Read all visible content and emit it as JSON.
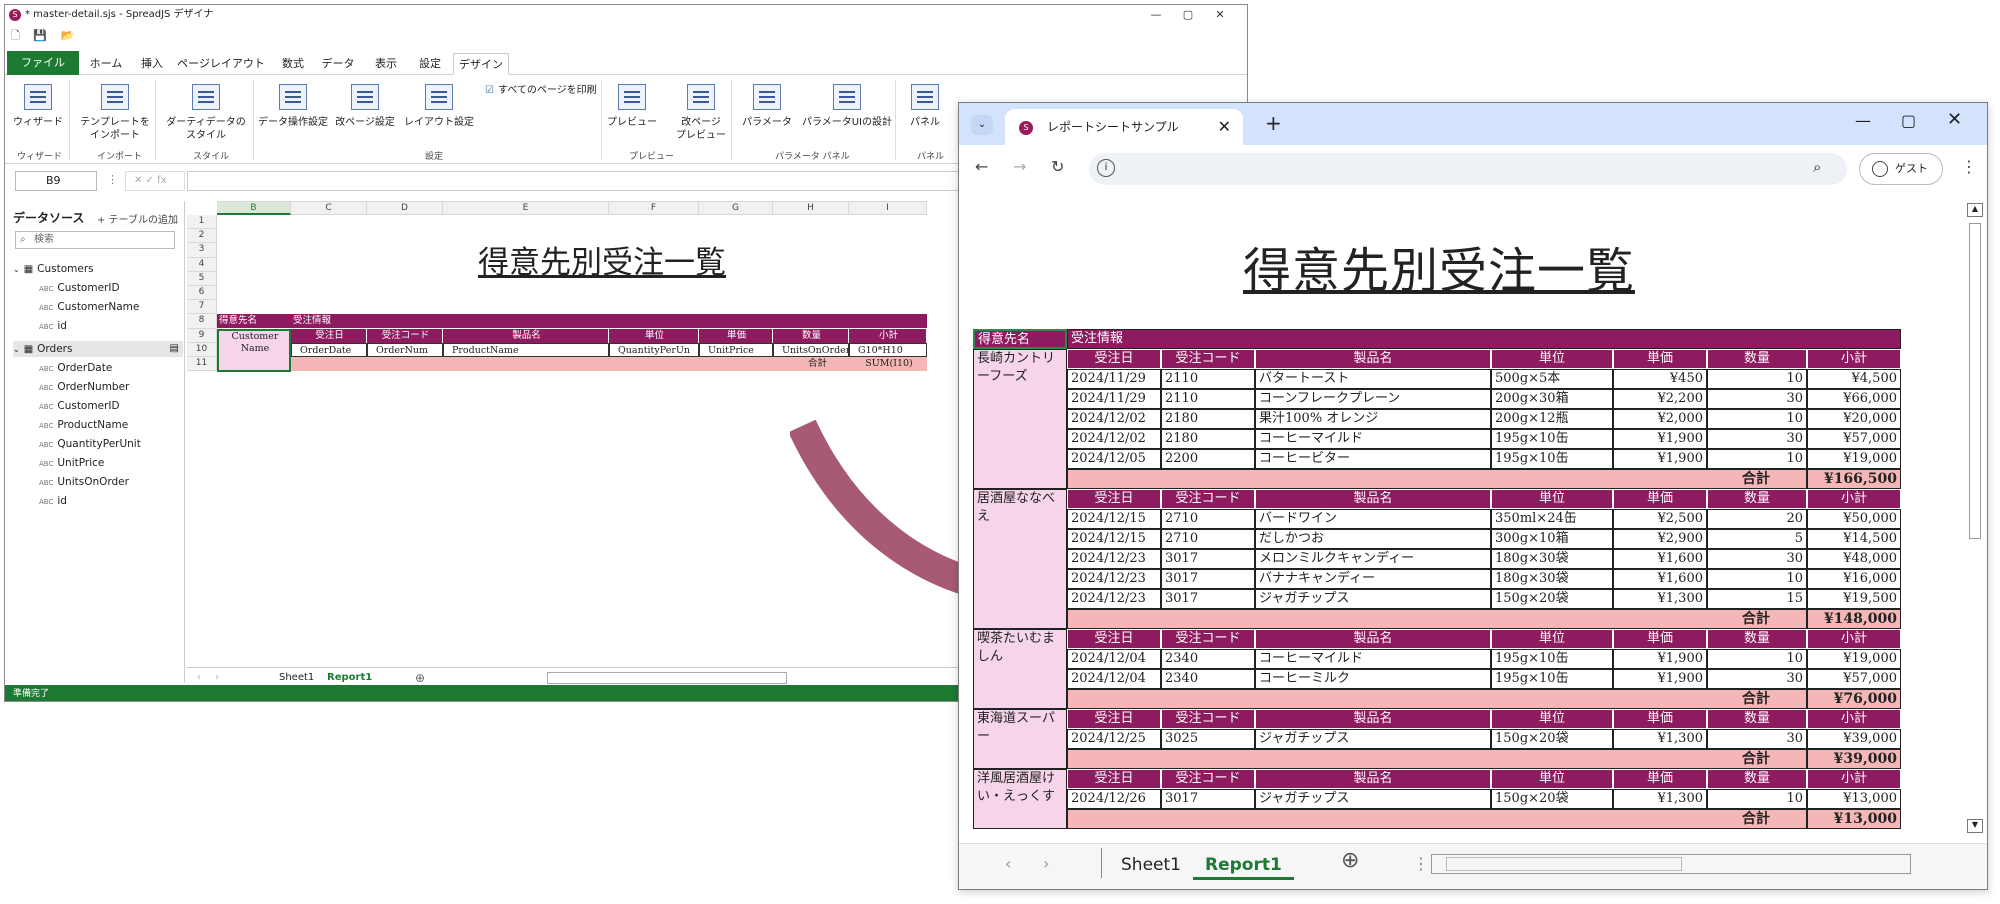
{
  "designer": {
    "title": "* master-detail.sjs - SpreadJS デザイナ",
    "tabs": [
      "ファイル",
      "ホーム",
      "挿入",
      "ページレイアウト",
      "数式",
      "データ",
      "表示",
      "設定",
      "デザイン"
    ],
    "ribbon": {
      "buttons": [
        "ウィザード",
        "テンプレートを\nインポート",
        "ダーティデータの\nスタイル",
        "データ操作設定",
        "改ページ設定",
        "レイアウト設定",
        "すべてのページを印刷",
        "プレビュー",
        "改ページ\nプレビュー",
        "パラメータ",
        "パラメータUIの設計",
        "パネル"
      ],
      "groups": [
        "ウィザード",
        "インポート",
        "スタイル",
        "設定",
        "プレビュー",
        "パラメータ パネル",
        "パネル"
      ]
    },
    "namebox": "B9",
    "fx": "fx",
    "datasource": {
      "title": "データソース",
      "add_table": "+ テーブルの追加",
      "search_placeholder": "検索",
      "tables": [
        {
          "name": "Customers",
          "fields": [
            "CustomerID",
            "CustomerName",
            "id"
          ]
        },
        {
          "name": "Orders",
          "fields": [
            "OrderDate",
            "OrderNumber",
            "CustomerID",
            "ProductName",
            "QuantityPerUnit",
            "UnitPrice",
            "UnitsOnOrder",
            "id"
          ]
        }
      ]
    },
    "columns": [
      "B",
      "C",
      "D",
      "E",
      "F",
      "G",
      "H",
      "I"
    ],
    "rows": [
      "1",
      "2",
      "3",
      "4",
      "5",
      "6",
      "7",
      "8",
      "9",
      "10",
      "11"
    ],
    "sheet_title": "得意先別受注一覧",
    "template": {
      "customer_header": "得意先名",
      "order_header": "受注情報",
      "field_headers": [
        "受注日",
        "受注コード",
        "製品名",
        "単位",
        "単価",
        "数量",
        "小計"
      ],
      "customer_field": "Customer\nName",
      "binding_cells": [
        "OrderDate",
        "OrderNum",
        "ProductName",
        "QuantityPerUn",
        "UnitPrice",
        "UnitsOnOrder",
        "G10*H10"
      ],
      "total_label": "合計",
      "total_formula": "SUM(I10)"
    },
    "sheet_tabs": [
      "Sheet1",
      "Report1"
    ],
    "status": "準備完了"
  },
  "browser": {
    "tab_title": "レポートシートサンプル",
    "guest_label": "ゲスト",
    "report_title": "得意先別受注一覧",
    "customer_header": "得意先名",
    "order_header": "受注情報",
    "field_headers": [
      "受注日",
      "受注コード",
      "製品名",
      "単位",
      "単価",
      "数量",
      "小計"
    ],
    "total_label": "合計",
    "groups": [
      {
        "customer": "長崎カントリーフーズ",
        "rows": [
          [
            "2024/11/29",
            "2110",
            "バタートースト",
            "500g×5本",
            "¥450",
            "10",
            "¥4,500"
          ],
          [
            "2024/11/29",
            "2110",
            "コーンフレークプレーン",
            "200g×30箱",
            "¥2,200",
            "30",
            "¥66,000"
          ],
          [
            "2024/12/02",
            "2180",
            "果汁100% オレンジ",
            "200g×12瓶",
            "¥2,000",
            "10",
            "¥20,000"
          ],
          [
            "2024/12/02",
            "2180",
            "コーヒーマイルド",
            "195g×10缶",
            "¥1,900",
            "30",
            "¥57,000"
          ],
          [
            "2024/12/05",
            "2200",
            "コーヒービター",
            "195g×10缶",
            "¥1,900",
            "10",
            "¥19,000"
          ]
        ],
        "total": "¥166,500"
      },
      {
        "customer": "居酒屋ななべえ",
        "rows": [
          [
            "2024/12/15",
            "2710",
            "バードワイン",
            "350ml×24缶",
            "¥2,500",
            "20",
            "¥50,000"
          ],
          [
            "2024/12/15",
            "2710",
            "だしかつお",
            "300g×10箱",
            "¥2,900",
            "5",
            "¥14,500"
          ],
          [
            "2024/12/23",
            "3017",
            "メロンミルクキャンディー",
            "180g×30袋",
            "¥1,600",
            "30",
            "¥48,000"
          ],
          [
            "2024/12/23",
            "3017",
            "バナナキャンディー",
            "180g×30袋",
            "¥1,600",
            "10",
            "¥16,000"
          ],
          [
            "2024/12/23",
            "3017",
            "ジャガチップス",
            "150g×20袋",
            "¥1,300",
            "15",
            "¥19,500"
          ]
        ],
        "total": "¥148,000"
      },
      {
        "customer": "喫茶たいむましん",
        "rows": [
          [
            "2024/12/04",
            "2340",
            "コーヒーマイルド",
            "195g×10缶",
            "¥1,900",
            "10",
            "¥19,000"
          ],
          [
            "2024/12/04",
            "2340",
            "コーヒーミルク",
            "195g×10缶",
            "¥1,900",
            "30",
            "¥57,000"
          ]
        ],
        "total": "¥76,000"
      },
      {
        "customer": "東海道スーパー",
        "rows": [
          [
            "2024/12/25",
            "3025",
            "ジャガチップス",
            "150g×20袋",
            "¥1,300",
            "30",
            "¥39,000"
          ]
        ],
        "total": "¥39,000"
      },
      {
        "customer": "洋風居酒屋けい・えっくす",
        "rows": [
          [
            "2024/12/26",
            "3017",
            "ジャガチップス",
            "150g×20袋",
            "¥1,300",
            "10",
            "¥13,000"
          ]
        ],
        "total": "¥13,000"
      }
    ],
    "sheet_tabs": [
      "Sheet1",
      "Report1"
    ]
  },
  "colors": {
    "magenta": "#8e1a5f",
    "pink": "#f6d5ea",
    "salmon": "#f4b6b6",
    "green": "#1d7a32",
    "arrow": "#a85a74"
  }
}
